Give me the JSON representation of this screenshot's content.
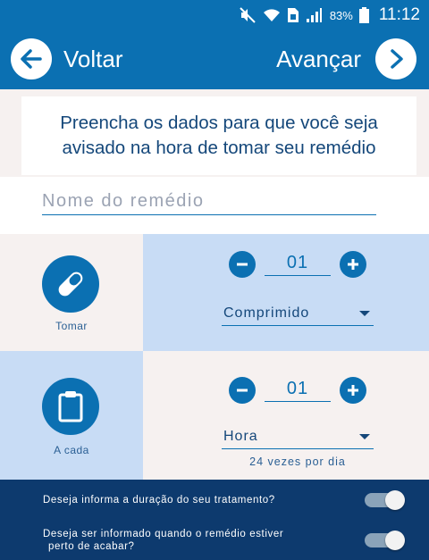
{
  "status_bar": {
    "battery_percent": "83%",
    "time": "11:12",
    "icons": [
      "mute-icon",
      "wifi-icon",
      "sim-icon",
      "signal-icon",
      "battery-icon"
    ]
  },
  "header": {
    "back_label": "Voltar",
    "next_label": "Avançar",
    "color": "#0b70b2"
  },
  "instructions": {
    "line1": "Preencha os dados para que você seja",
    "line2": "avisado na hora de tomar seu remédio"
  },
  "medicine_name": {
    "placeholder": "Nome do remédio",
    "value": ""
  },
  "dose": {
    "label": "Tomar",
    "icon": "pill-icon",
    "quantity": "01",
    "unit": "Comprimido"
  },
  "interval": {
    "label": "A cada",
    "icon": "clipboard-icon",
    "quantity": "01",
    "unit": "Hora",
    "summary": "24 vezes por dia"
  },
  "settings": {
    "duration_question": "Deseja informa a duração do seu tratamento?",
    "ending_question_line1": "Deseja ser informado quando o remédio estiver",
    "ending_question_line2": "perto de acabar?",
    "duration_enabled": true,
    "ending_enabled": true
  },
  "colors": {
    "accent": "#0b70b2",
    "dark_panel": "#0d3a6e",
    "light_cell": "#f6f1f0",
    "blue_cell": "#c8dcf5"
  }
}
